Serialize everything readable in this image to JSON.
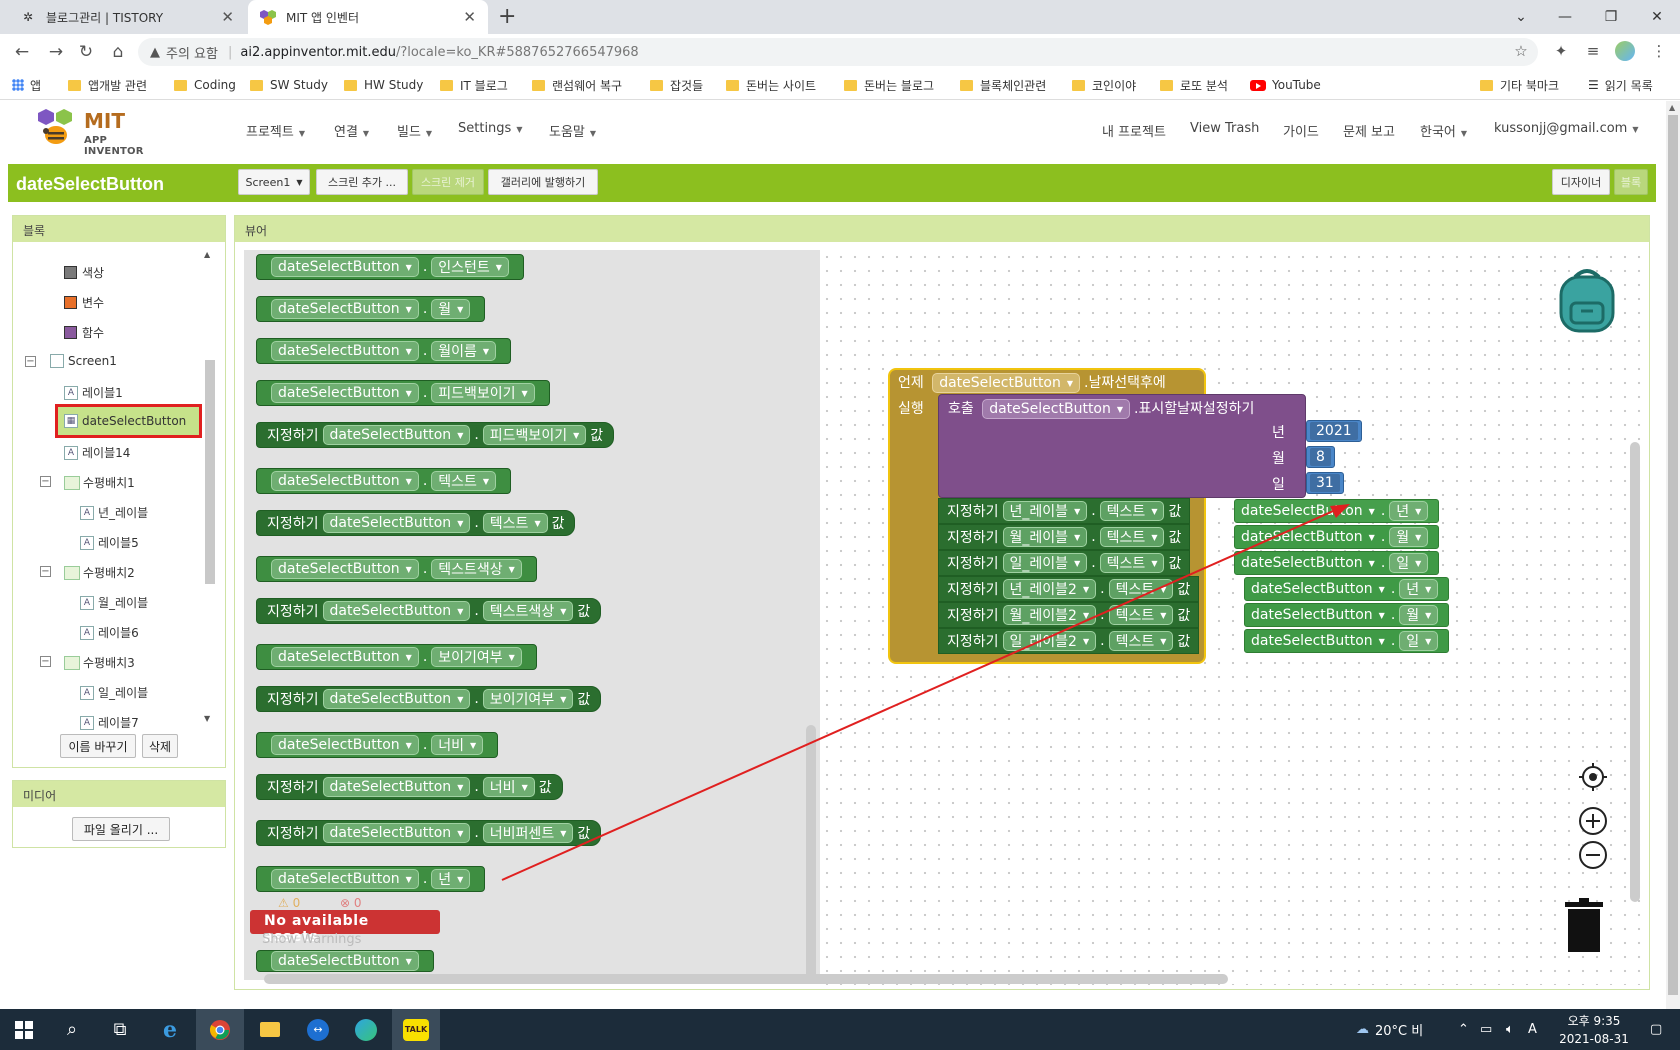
{
  "browser": {
    "tabs": [
      {
        "title": "블로그관리 | TISTORY",
        "active": false
      },
      {
        "title": "MIT 앱 인벤터",
        "active": true
      }
    ],
    "security_label": "주의 요함",
    "url_host": "ai2.appinventor.mit.edu",
    "url_path": "/?locale=ko_KR#5887652766547968",
    "bookmarks": [
      "앱",
      "앱개발 관련",
      "Coding",
      "SW Study",
      "HW Study",
      "IT 블로그",
      "랜섬웨어 복구",
      "잡것들",
      "돈버는 사이트",
      "돈버는 블로그",
      "블록체인관련",
      "코인이야",
      "로또 분석",
      "YouTube"
    ],
    "bookmarks_right": [
      "기타 북마크",
      "읽기 목록"
    ]
  },
  "app": {
    "logo_top": "MIT",
    "logo_bottom": "APP INVENTOR",
    "menu": [
      "프로젝트",
      "연결",
      "빌드",
      "Settings",
      "도움말"
    ],
    "right_menu": [
      "내 프로젝트",
      "View Trash",
      "가이드",
      "문제 보고",
      "한국어",
      "kussonjj@gmail.com"
    ],
    "project_title": "dateSelectButton",
    "toolbar": {
      "screen": "Screen1",
      "add_screen": "스크린 추가 ...",
      "remove_screen": "스크린 제거",
      "publish": "갤러리에 발행하기",
      "designer": "디자이너",
      "blocks": "블록"
    }
  },
  "blocks_panel": {
    "title": "블록",
    "builtins": [
      {
        "label": "색상",
        "color": "#7a7a7a"
      },
      {
        "label": "변수",
        "color": "#e8702a"
      },
      {
        "label": "함수",
        "color": "#8a5a9e"
      }
    ],
    "screen": "Screen1",
    "components": [
      "레이블1",
      "dateSelectButton",
      "레이블14",
      "수평배치1",
      "년_레이블",
      "레이블5",
      "수평배치2",
      "월_레이블",
      "레이블6",
      "수평배치3",
      "일_레이블",
      "레이블7"
    ],
    "rename_button": "이름 바꾸기",
    "delete_button": "삭제"
  },
  "media_panel": {
    "title": "미디어",
    "upload_button": "파일 올리기 ..."
  },
  "viewer": {
    "title": "뷰어",
    "flyout_blocks": [
      {
        "kind": "get",
        "component": "dateSelectButton",
        "prop": "인스턴트"
      },
      {
        "kind": "get",
        "component": "dateSelectButton",
        "prop": "월"
      },
      {
        "kind": "get",
        "component": "dateSelectButton",
        "prop": "월이름"
      },
      {
        "kind": "get",
        "component": "dateSelectButton",
        "prop": "피드백보이기"
      },
      {
        "kind": "set",
        "component": "dateSelectButton",
        "prop": "피드백보이기"
      },
      {
        "kind": "get",
        "component": "dateSelectButton",
        "prop": "텍스트"
      },
      {
        "kind": "set",
        "component": "dateSelectButton",
        "prop": "텍스트"
      },
      {
        "kind": "get",
        "component": "dateSelectButton",
        "prop": "텍스트색상"
      },
      {
        "kind": "set",
        "component": "dateSelectButton",
        "prop": "텍스트색상"
      },
      {
        "kind": "get",
        "component": "dateSelectButton",
        "prop": "보이기여부"
      },
      {
        "kind": "set",
        "component": "dateSelectButton",
        "prop": "보이기여부"
      },
      {
        "kind": "get",
        "component": "dateSelectButton",
        "prop": "너비"
      },
      {
        "kind": "set",
        "component": "dateSelectButton",
        "prop": "너비"
      },
      {
        "kind": "set",
        "component": "dateSelectButton",
        "prop": "너비퍼센트"
      },
      {
        "kind": "get",
        "component": "dateSelectButton",
        "prop": "년"
      },
      {
        "kind": "get",
        "component": "dateSelectButton",
        "prop": ""
      }
    ],
    "set_word": "지정하기",
    "value_word": "값",
    "warnings": {
      "warn_count": "0",
      "error_count": "0",
      "message": "No available assets",
      "show": "Show Warnings"
    },
    "event": {
      "when_word": "언제",
      "component": "dateSelectButton",
      "event_name": ".날짜선택후에",
      "do_word": "실행",
      "call_word": "호출",
      "call_component": "dateSelectButton",
      "method": ".표시할날짜설정하기",
      "params": [
        {
          "name": "년",
          "value": "2021"
        },
        {
          "name": "월",
          "value": "8"
        },
        {
          "name": "일",
          "value": "31"
        }
      ],
      "set_rows": [
        {
          "target": "년_레이블",
          "prop": "텍스트",
          "src_component": "dateSelectButton",
          "src_prop": "년"
        },
        {
          "target": "월_레이블",
          "prop": "텍스트",
          "src_component": "dateSelectButton",
          "src_prop": "월"
        },
        {
          "target": "일_레이블",
          "prop": "텍스트",
          "src_component": "dateSelectButton",
          "src_prop": "일"
        },
        {
          "target": "년_레이블2",
          "prop": "텍스트",
          "src_component": "dateSelectButton",
          "src_prop": "년"
        },
        {
          "target": "월_레이블2",
          "prop": "텍스트",
          "src_component": "dateSelectButton",
          "src_prop": "월"
        },
        {
          "target": "일_레이블2",
          "prop": "텍스트",
          "src_component": "dateSelectButton",
          "src_prop": "일"
        }
      ]
    }
  },
  "taskbar": {
    "weather": "20°C 비",
    "ime": "A",
    "time": "오후 9:35",
    "date": "2021-08-31"
  },
  "colors": {
    "green_bar": "#8cbf1f",
    "component_block": "#2e7d32",
    "event_block": "#b79432",
    "call_block": "#7f4f8b",
    "number_block": "#4a86c8",
    "highlight": "#e02020"
  }
}
